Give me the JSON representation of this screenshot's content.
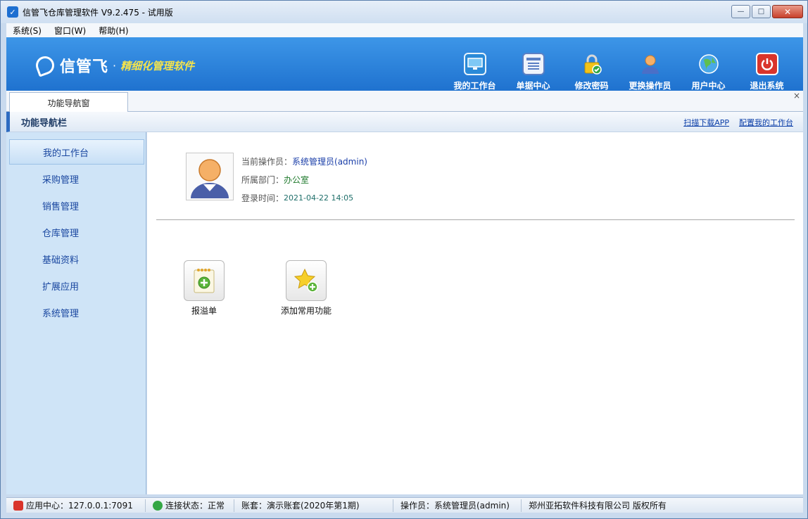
{
  "window": {
    "title": "信管飞仓库管理软件 V9.2.475 - 试用版",
    "controls": {
      "minimize": "—",
      "maximize": "□",
      "close": "✕"
    }
  },
  "menu": [
    {
      "label": "系统(S)"
    },
    {
      "label": "窗口(W)"
    },
    {
      "label": "帮助(H)"
    }
  ],
  "banner": {
    "brand": "信管飞",
    "dot": "·",
    "slogan": "精细化管理软件",
    "tools": [
      {
        "label": "我的工作台",
        "icon": "monitor-icon",
        "color": "#2a8ad8"
      },
      {
        "label": "单据中心",
        "icon": "document-list-icon",
        "color": "#5a7fc4"
      },
      {
        "label": "修改密码",
        "icon": "lock-icon",
        "color": "#e0b72b"
      },
      {
        "label": "更换操作员",
        "icon": "user-icon",
        "color": "#e6913a"
      },
      {
        "label": "用户中心",
        "icon": "globe-icon",
        "color": "#2fa34a"
      },
      {
        "label": "退出系统",
        "icon": "power-icon",
        "color": "#d9342b"
      }
    ]
  },
  "tabs": [
    {
      "label": "功能导航窗"
    }
  ],
  "tab_close": "×",
  "nav": {
    "title": "功能导航栏",
    "links": [
      {
        "label": "扫描下载APP"
      },
      {
        "label": "配置我的工作台"
      }
    ]
  },
  "sidebar": {
    "items": [
      {
        "label": "我的工作台",
        "active": true
      },
      {
        "label": "采购管理"
      },
      {
        "label": "销售管理"
      },
      {
        "label": "仓库管理"
      },
      {
        "label": "基础资料"
      },
      {
        "label": "扩展应用"
      },
      {
        "label": "系统管理"
      }
    ]
  },
  "workbench": {
    "operator_label": "当前操作员：",
    "operator_value": "系统管理员(admin)",
    "dept_label": "所属部门：",
    "dept_value": "办公室",
    "login_label": "登录时间：",
    "login_value": "2021-04-22 14:05",
    "shortcuts": [
      {
        "label": "报溢单",
        "icon": "notepad-add-icon"
      },
      {
        "label": "添加常用功能",
        "icon": "star-add-icon"
      }
    ]
  },
  "status": {
    "server": "应用中心：127.0.0.1:7091",
    "connection": "连接状态：正常",
    "account": "账套：演示账套(2020年第1期)",
    "operator": "操作员：系统管理员(admin)",
    "company": "郑州亚拓软件科技有限公司 版权所有"
  }
}
